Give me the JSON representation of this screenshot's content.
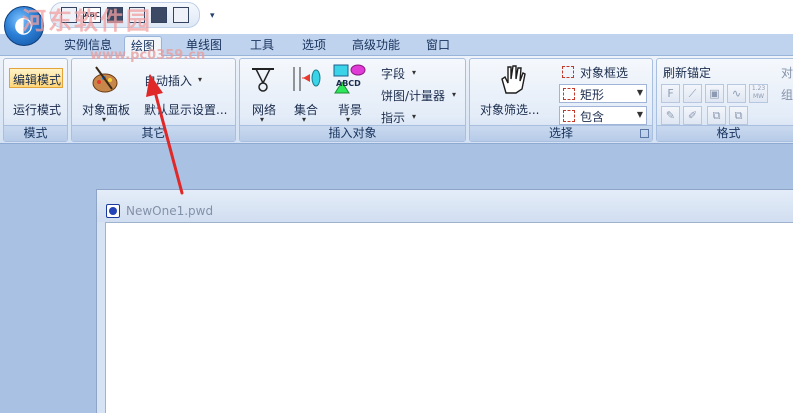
{
  "watermark": {
    "site": "河东软件园",
    "url": "www.pc0359.cn"
  },
  "quick_access": {
    "txt_label": "ABC",
    "more": "▾"
  },
  "tabs": [
    "实例信息",
    "绘图",
    "单线图",
    "工具",
    "选项",
    "高级功能",
    "窗口"
  ],
  "active_tab": "绘图",
  "ribbon": {
    "mode": {
      "label": "模式",
      "edit": "编辑模式",
      "run": "运行模式"
    },
    "other": {
      "label": "其它",
      "object_panel": "对象面板",
      "auto_insert": "自动插入",
      "default_display": "默认显示设置..."
    },
    "insert": {
      "label": "插入对象",
      "network": "网络",
      "collection": "集合",
      "background": "背景",
      "field": "字段",
      "pie_meter": "饼图/计量器",
      "indicator": "指示",
      "abcd": "ABCD"
    },
    "select": {
      "label": "选择",
      "object_filter": "对象筛选...",
      "object_frame_select": "对象框选",
      "shape_value": "矩形",
      "contain_value": "包含"
    },
    "format": {
      "label": "格式",
      "refresh_anchor": "刷新锚定",
      "cut_1": "对",
      "cut_2": "组",
      "f_glyph": "F",
      "mw_glyph": "1.23 MW"
    }
  },
  "document": {
    "title": "NewOne1.pwd"
  },
  "colors": {
    "annotation_arrow": "#e02828",
    "highlight": "#ffd77c"
  }
}
